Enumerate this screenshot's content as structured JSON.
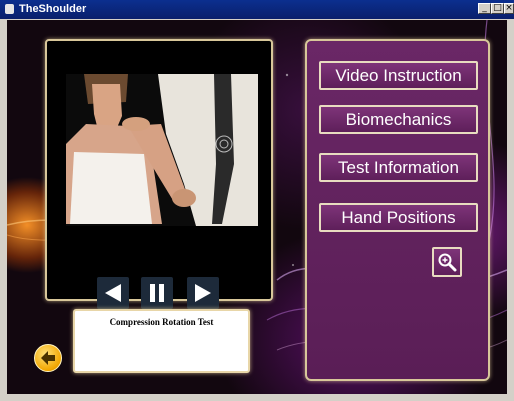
{
  "window": {
    "title": "TheShoulder",
    "minimize": "_",
    "maximize": "□",
    "close": "×"
  },
  "video": {
    "controls": [
      "previous",
      "pause",
      "next"
    ]
  },
  "caption": {
    "text": "Compression Rotation Test"
  },
  "menu": {
    "items": [
      {
        "label": "Video Instruction"
      },
      {
        "label": "Biomechanics"
      },
      {
        "label": "Test Information"
      },
      {
        "label": "Hand Positions"
      }
    ]
  },
  "colors": {
    "accent_purple": "#6a2766",
    "border_gold": "#d8c79a",
    "back_orange": "#f2a600"
  },
  "icons": {
    "back": "back-arrow-icon",
    "zoom": "magnifier-icon"
  }
}
